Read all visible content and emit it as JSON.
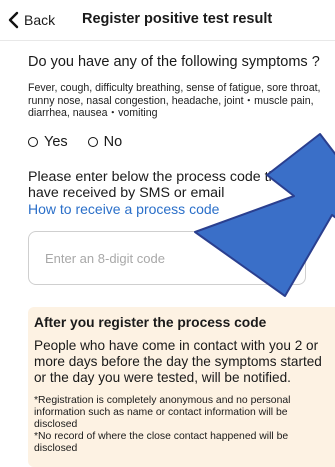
{
  "header": {
    "back_label": "Back",
    "title": "Register positive test result"
  },
  "form": {
    "question": "Do you have any of the following symptoms ?",
    "symptoms": "Fever, cough, difficulty breathing, sense of fatigue, sore throat, runny nose, nasal congestion, headache, joint・muscle pain, diarrhea, nausea・vomiting",
    "options": [
      {
        "label": "Yes",
        "selected": false
      },
      {
        "label": "No",
        "selected": false
      }
    ],
    "instruction": "Please enter below the process code that you have received by SMS or email",
    "howto_link": "How to receive a process code",
    "code_placeholder": "Enter an 8-digit code",
    "code_value": ""
  },
  "info": {
    "title": "After you register the process code",
    "body": "People who have come in contact with you 2 or more days before the day the symptoms started or the day you were tested, will be notified.",
    "note_1": "*Registration is completely anonymous and no personal information such as name or contact information will be disclosed",
    "note_2": "*No record of where the close contact happened will be disclosed"
  },
  "overlay": {
    "arrow_color": "#3a6fc8",
    "arrow_outline": "#2a3f8f"
  }
}
